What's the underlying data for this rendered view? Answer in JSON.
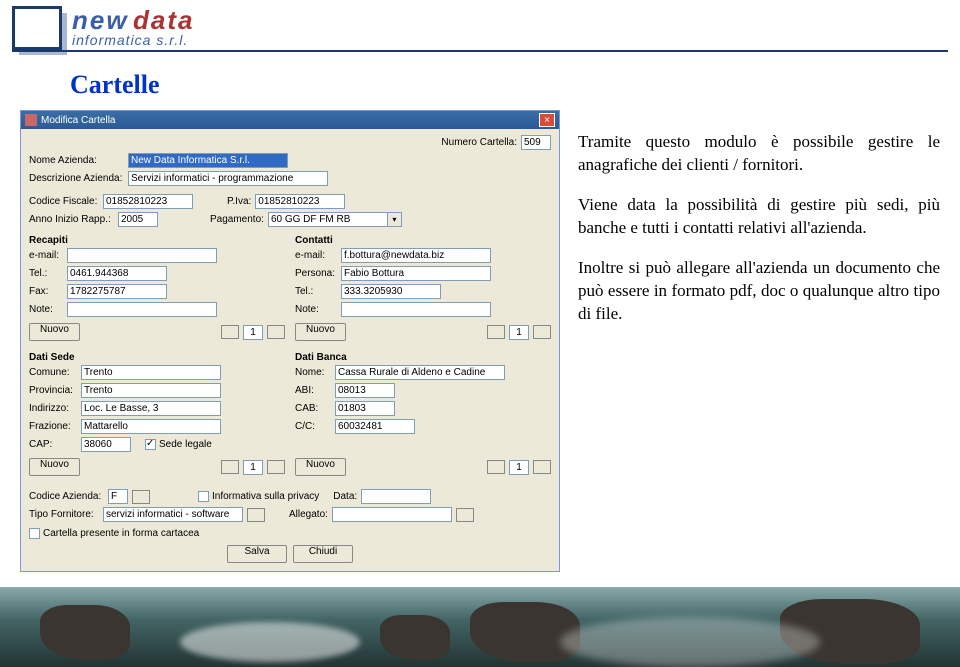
{
  "brand": {
    "w1": "new",
    "w2": "data",
    "sub": "informatica s.r.l."
  },
  "page_title": "Cartelle",
  "dialog": {
    "title": "Modifica Cartella",
    "numero_lbl": "Numero Cartella:",
    "numero": "509",
    "nome_az_lbl": "Nome Azienda:",
    "nome_az": "New Data Informatica S.r.l.",
    "desc_lbl": "Descrizione Azienda:",
    "desc": "Servizi informatici - programmazione",
    "cf_lbl": "Codice Fiscale:",
    "cf": "01852810223",
    "piva_lbl": "P.Iva:",
    "piva": "01852810223",
    "anno_lbl": "Anno Inizio Rapp.:",
    "anno": "2005",
    "pag_lbl": "Pagamento:",
    "pag": "60 GG DF FM RB",
    "recapiti": "Recapiti",
    "contatti": "Contatti",
    "email_lbl": "e-mail:",
    "email1": "",
    "email2": "f.bottura@newdata.biz",
    "persona_lbl": "Persona:",
    "persona": "Fabio Bottura",
    "tel_lbl": "Tel.:",
    "tel1": "0461.944368",
    "tel2": "333.3205930",
    "fax_lbl": "Fax:",
    "fax": "1782275787",
    "note_lbl": "Note:",
    "note1": "",
    "note2": "",
    "nuovo_lbl": "Nuovo",
    "val1": "1",
    "dati_sede": "Dati Sede",
    "dati_banca": "Dati Banca",
    "comune_lbl": "Comune:",
    "comune": "Trento",
    "prov_lbl": "Provincia:",
    "prov": "Trento",
    "indirizzo_lbl": "Indirizzo:",
    "indirizzo": "Loc. Le Basse, 3",
    "frazione_lbl": "Frazione:",
    "frazione": "Mattarello",
    "cap_lbl": "CAP:",
    "cap": "38060",
    "sede_legale": "Sede legale",
    "banca_nome_lbl": "Nome:",
    "banca_nome": "Cassa Rurale di Aldeno e Cadine",
    "abi_lbl": "ABI:",
    "abi": "08013",
    "cab_lbl": "CAB:",
    "cab": "01803",
    "cc_lbl": "C/C:",
    "cc": "60032481",
    "cod_az_lbl": "Codice Azienda:",
    "cod_az": "F",
    "inf_privacy": "Informativa sulla privacy",
    "data_lbl": "Data:",
    "tipo_lbl": "Tipo Fornitore:",
    "tipo": "servizi informatici - software",
    "allegato_lbl": "Allegato:",
    "cartacea": "Cartella presente in forma cartacea",
    "salva": "Salva",
    "chiudi": "Chiudi"
  },
  "body_text": {
    "p1": "Tramite questo modulo è possibile gestire le anagrafiche dei clienti / fornitori.",
    "p2": "Viene data la possibilità di gestire più sedi, più banche e tutti i contatti relativi all'azienda.",
    "p3": "Inoltre si può allegare all'azienda un documento che può essere in formato pdf, doc o qualunque altro tipo di file."
  }
}
